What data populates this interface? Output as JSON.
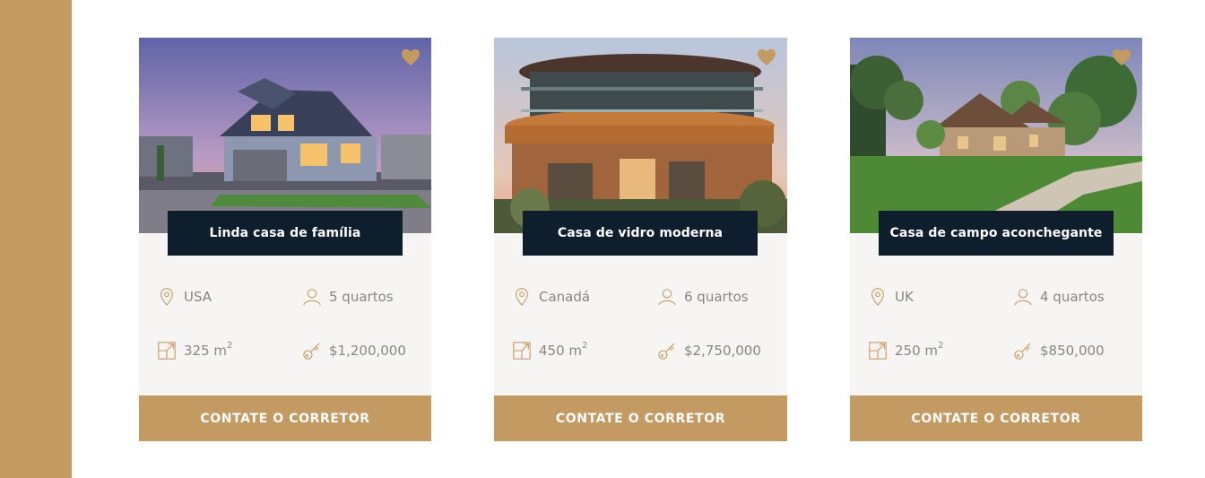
{
  "colors": {
    "accent": "#c49a63",
    "dark": "#0f1e2d",
    "card_bg": "#f7f5f3",
    "text": "#8a8580"
  },
  "properties": [
    {
      "title": "Linda casa de família",
      "location": "USA",
      "rooms": "5 quartos",
      "area": "325 m",
      "area_exp": "2",
      "price": "$1,200,000",
      "cta": "CONTATE O CORRETOR"
    },
    {
      "title": "Casa de vidro moderna",
      "location": "Canadá",
      "rooms": "6 quartos",
      "area": "450 m",
      "area_exp": "2",
      "price": "$2,750,000",
      "cta": "CONTATE O CORRETOR"
    },
    {
      "title": "Casa de campo aconchegante",
      "location": "UK",
      "rooms": "4 quartos",
      "area": "250 m",
      "area_exp": "2",
      "price": "$850,000",
      "cta": "CONTATE O CORRETOR"
    }
  ],
  "icons": {
    "favorite": "heart-icon",
    "location": "map-pin-icon",
    "rooms": "user-icon",
    "area": "area-icon",
    "price": "key-icon"
  }
}
